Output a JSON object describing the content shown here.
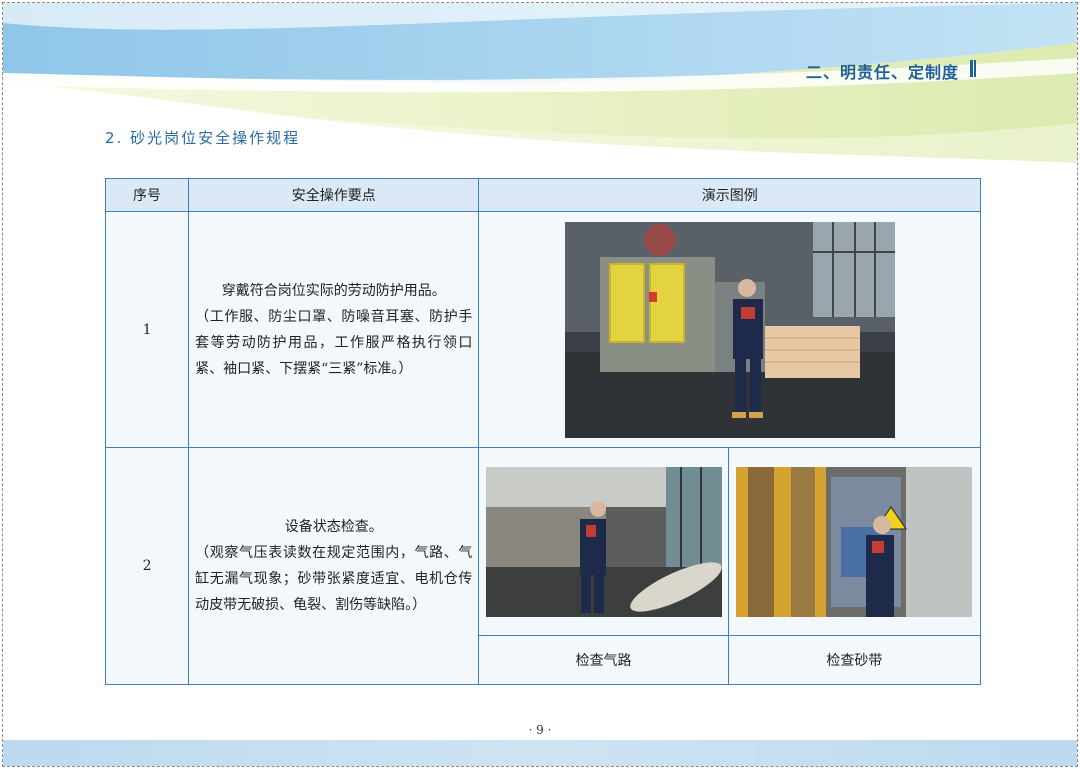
{
  "header": {
    "section_title": "二、明责任、定制度"
  },
  "subtitle": "2. 砂光岗位安全操作规程",
  "table": {
    "headers": [
      "序号",
      "安全操作要点",
      "演示图例"
    ],
    "rows": [
      {
        "no": "1",
        "main": "穿戴符合岗位实际的劳动防护用品。",
        "detail": "（工作服、防尘口罩、防噪音耳塞、防护手套等劳动防护用品，工作服严格执行领口紧、袖口紧、下摆紧“三紧”标准。）",
        "photo": "sanding-machine-operator-standing-photo"
      },
      {
        "no": "2",
        "main": "设备状态检查。",
        "detail": "（观察气压表读数在规定范围内，气路、气缸无漏气现象；砂带张紧度适宜、电机仓传动皮带无破损、龟裂、割伤等缺陷。）",
        "photo_left": "worker-checking-air-line-photo",
        "photo_right": "worker-checking-sanding-belt-photo",
        "caption_left": "检查气路",
        "caption_right": "检查砂带"
      }
    ]
  },
  "footer": {
    "page_number": "· 9 ·"
  },
  "colors": {
    "accent": "#1f5f9a",
    "table_border": "#3d7fc1",
    "header_fill": "#dbe9f7",
    "cell_fill": "#f3f8fd"
  }
}
